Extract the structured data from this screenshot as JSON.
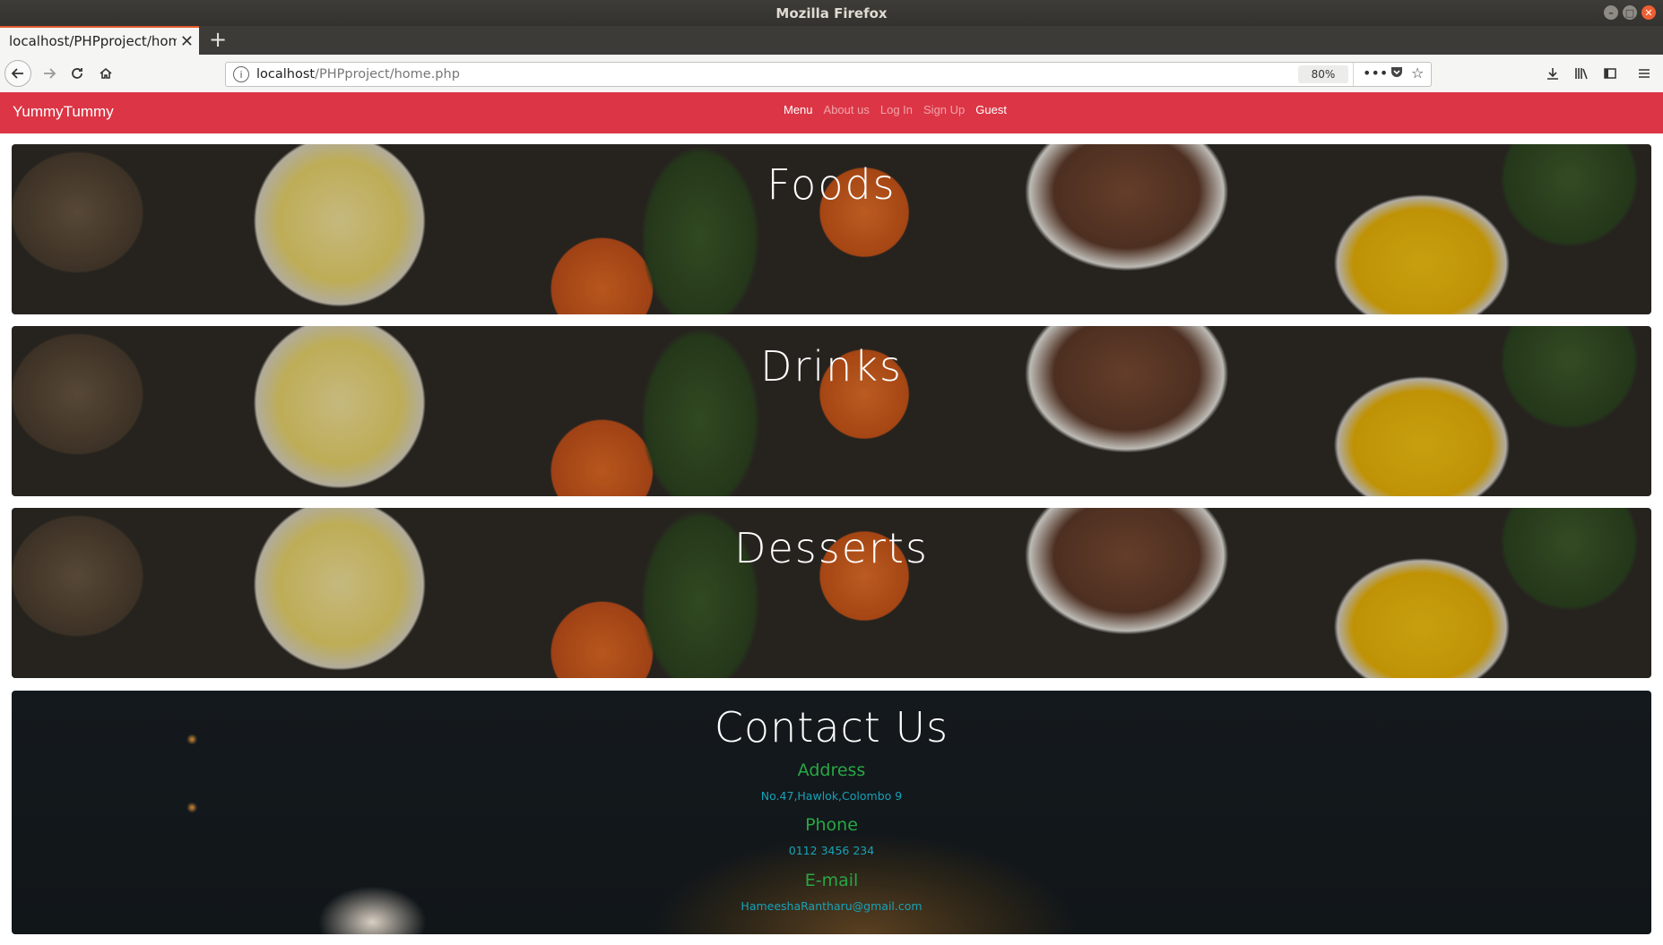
{
  "window": {
    "title": "Mozilla Firefox"
  },
  "browser": {
    "tab_title": "localhost/PHPproject/home.php",
    "url_host": "localhost",
    "url_path": "/PHPproject/home.php",
    "zoom": "80%"
  },
  "site": {
    "brand": "YummyTummy",
    "nav": [
      "Menu",
      "About us",
      "Log In",
      "Sign Up",
      "Guest"
    ]
  },
  "sections": [
    "Foods",
    "Drinks",
    "Desserts"
  ],
  "contact": {
    "title": "Contact Us",
    "address_label": "Address",
    "address": "No.47,Hawlok,Colombo 9",
    "phone_label": "Phone",
    "phone": "0112 3456 234",
    "email_label": "E-mail",
    "email": "HameeshaRantharu@gmail.com"
  }
}
